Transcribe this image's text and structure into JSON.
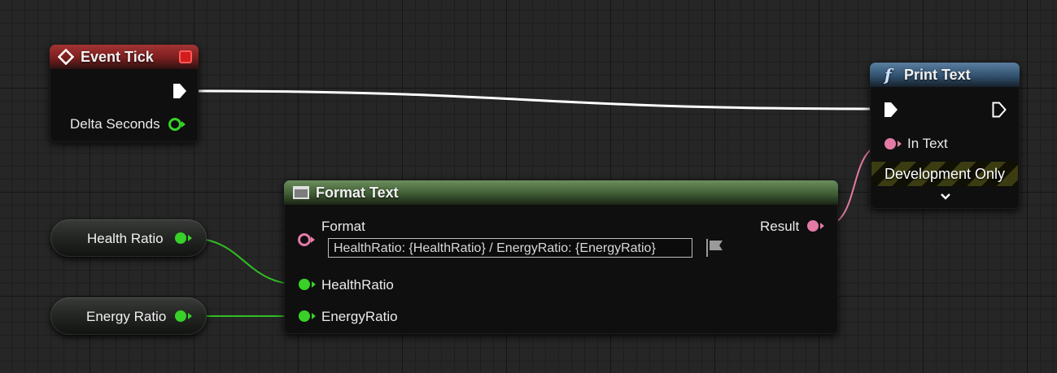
{
  "event_tick": {
    "title": "Event Tick",
    "delta_label": "Delta Seconds"
  },
  "print_text": {
    "title": "Print Text",
    "in_text_label": "In Text",
    "dev_only_label": "Development Only"
  },
  "format_text": {
    "title": "Format Text",
    "format_label": "Format",
    "format_value": "HealthRatio: {HealthRatio} / EnergyRatio: {EnergyRatio}",
    "result_label": "Result",
    "health_pin_label": "HealthRatio",
    "energy_pin_label": "EnergyRatio"
  },
  "variables": {
    "health_label": "Health Ratio",
    "energy_label": "Energy Ratio"
  },
  "colors": {
    "exec_wire": "#ffffff",
    "float_pin": "#38d12a",
    "text_pin": "#e47aa6",
    "event_header": "#8b2626",
    "function_header": "#41627f",
    "pure_header": "#4c6e40",
    "grid_background": "#262626"
  },
  "icons": {
    "event": "diamond-event-icon",
    "function": "function-f-icon",
    "format_text": "format-text-icon",
    "localization": "flag-icon",
    "expand": "chevron-down-icon"
  }
}
